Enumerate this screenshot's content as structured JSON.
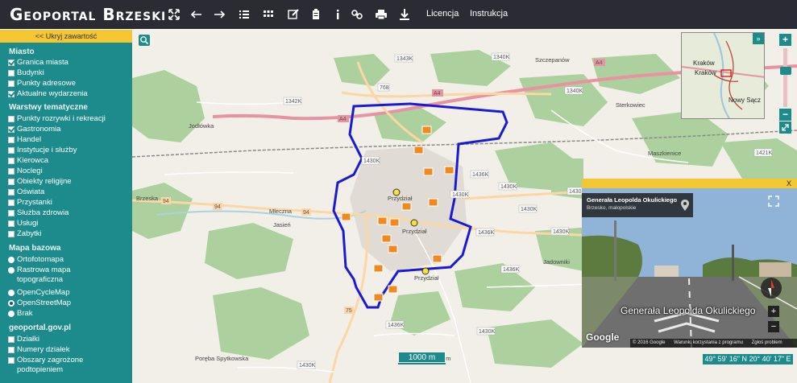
{
  "header": {
    "title": "Geoportal Brzeski",
    "icons": [
      "extent-icon",
      "back-arrow-icon",
      "forward-arrow-icon",
      "legend-list-icon",
      "table-grid-icon",
      "edit-icon",
      "clipboard-icon",
      "info-icon",
      "link-icon",
      "print-icon",
      "measure-icon"
    ],
    "links": [
      "Licencja",
      "Instrukcja"
    ]
  },
  "sidebar": {
    "hide_label": "<< Ukryj zawartość",
    "sections": [
      {
        "title": "Miasto",
        "items": [
          {
            "label": "Granica miasta",
            "checked": true
          },
          {
            "label": "Budynki",
            "checked": false
          },
          {
            "label": "Punkty adresowe",
            "checked": false
          },
          {
            "label": "Aktualne wydarzenia",
            "checked": true
          }
        ]
      },
      {
        "title": "Warstwy tematyczne",
        "items": [
          {
            "label": "Punkty rozrywki i rekreacji",
            "checked": false
          },
          {
            "label": "Gastronomia",
            "checked": true
          },
          {
            "label": "Handel",
            "checked": false
          },
          {
            "label": "Instytucje i służby",
            "checked": false
          },
          {
            "label": "Kierowca",
            "checked": false
          },
          {
            "label": "Noclegi",
            "checked": false
          },
          {
            "label": "Obiekty religijne",
            "checked": false
          },
          {
            "label": "Oświata",
            "checked": false
          },
          {
            "label": "Przystanki",
            "checked": false
          },
          {
            "label": "Służba zdrowia",
            "checked": false
          },
          {
            "label": "Usługi",
            "checked": false
          },
          {
            "label": "Zabytki",
            "checked": false
          }
        ]
      },
      {
        "title": "Mapa bazowa",
        "radios": [
          {
            "label": "Ortofotomapa",
            "selected": false
          },
          {
            "label": "Rastrowa mapa topograficzna",
            "selected": false
          },
          {
            "label": "OpenCycleMap",
            "selected": false
          },
          {
            "label": "OpenStreetMap",
            "selected": true
          },
          {
            "label": "Brak",
            "selected": false
          }
        ]
      },
      {
        "title": "geoportal.gov.pl",
        "items": [
          {
            "label": "Działki",
            "checked": false
          },
          {
            "label": "Numery działek",
            "checked": false
          },
          {
            "label": "Obszary zagrożone podtopieniem",
            "checked": false
          }
        ]
      }
    ]
  },
  "map": {
    "road_labels": [
      "1343K",
      "1340K",
      "1342K",
      "1340K",
      "A4",
      "768",
      "A4",
      "A4",
      "1421K",
      "1430K",
      "1436K",
      "1430K",
      "1430K",
      "1430K",
      "94",
      "94",
      "94",
      "1430K",
      "1436K",
      "1436K",
      "75",
      "1436K",
      "1430K",
      "1430K",
      "1430K"
    ],
    "place_labels": [
      "Szczepanów",
      "Jodłówka",
      "Sterkowiec",
      "Maszkienice",
      "Jasień",
      "Jadowniki",
      "Okocim",
      "Poręba Spytkowska",
      "Mleczna",
      "Brzeska",
      "Przydział",
      "Przydział",
      "Przydział"
    ],
    "scale_label": "1000 m",
    "coordinates": "49° 59' 16\" N 20° 40' 17\" E",
    "zoom_level": 0.4,
    "colors": {
      "boundary": "#1a1ad6",
      "forest": "#add19e",
      "highway": "#e892a2",
      "primary_road": "#fcd6a4",
      "accent": "#1d8a8c",
      "highlight": "#f5c633"
    }
  },
  "overview": {
    "labels": [
      "Kraków",
      "Kraków",
      "Nowy Sącz"
    ],
    "toggle_symbol": "»"
  },
  "street_view": {
    "close_label": "X",
    "street_name": "Generała Leopolda Okulickiego",
    "region": "Brzesko, małopolskie",
    "road_overlay": "Generała Leopolda Okulickiego",
    "google_logo": "Google",
    "footer": [
      "© 2016 Google",
      "Warunki korzystania z programu",
      "Zgłoś problem"
    ]
  },
  "controls": {
    "zoom_in": "+",
    "zoom_out": "−",
    "sv_zoom_in": "+",
    "sv_zoom_out": "−"
  }
}
